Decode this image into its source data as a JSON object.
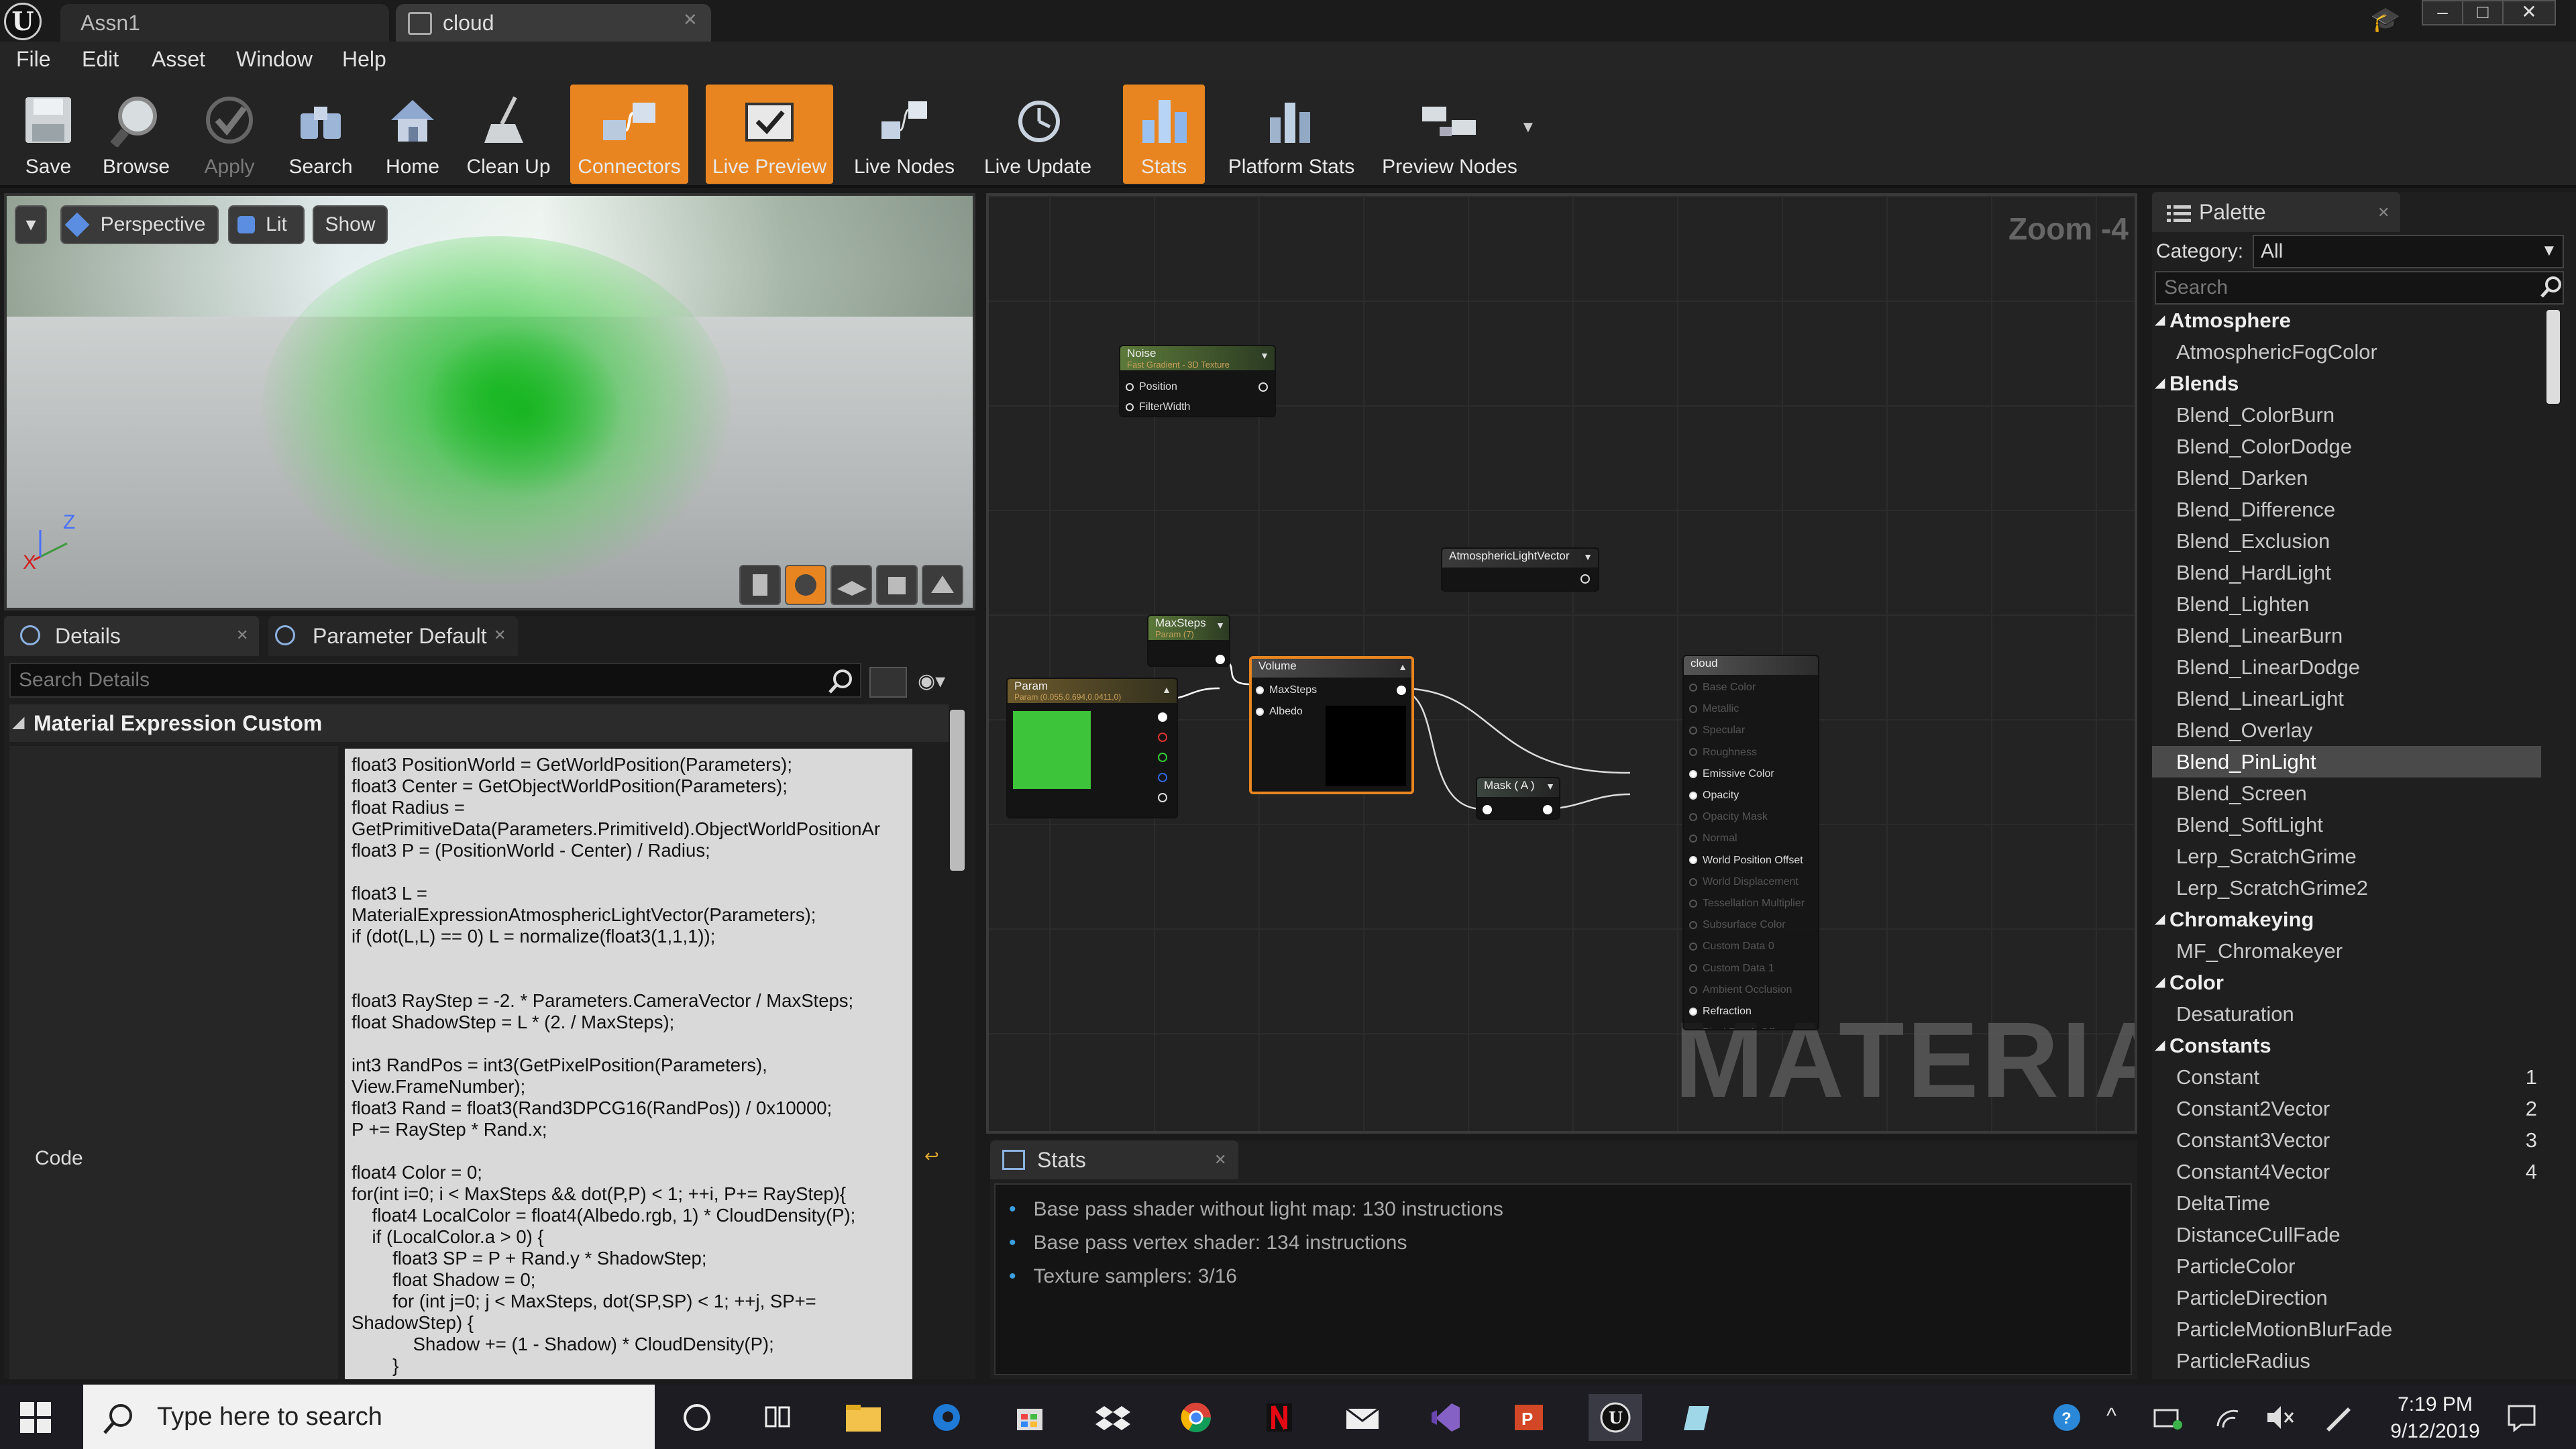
{
  "window": {
    "tabs": [
      {
        "label": "Assn1"
      },
      {
        "label": "cloud"
      }
    ],
    "controls": {
      "minimize": "–",
      "maximize": "□",
      "close": "✕"
    }
  },
  "menu": {
    "items": [
      "File",
      "Edit",
      "Asset",
      "Window",
      "Help"
    ]
  },
  "toolbar": {
    "buttons": [
      {
        "label": "Save",
        "icon": "save-icon",
        "active": false
      },
      {
        "label": "Browse",
        "icon": "browse-icon",
        "active": false
      },
      {
        "label": "Apply",
        "icon": "apply-icon",
        "active": false,
        "disabled": true
      },
      {
        "label": "Search",
        "icon": "search-icon",
        "active": false
      },
      {
        "label": "Home",
        "icon": "home-icon",
        "active": false
      },
      {
        "label": "Clean Up",
        "icon": "clean-up-icon",
        "active": false
      },
      {
        "label": "Connectors",
        "icon": "connectors-icon",
        "active": true
      },
      {
        "label": "Live Preview",
        "icon": "live-preview-icon",
        "active": true
      },
      {
        "label": "Live Nodes",
        "icon": "live-nodes-icon",
        "active": false
      },
      {
        "label": "Live Update",
        "icon": "live-update-icon",
        "active": false
      },
      {
        "label": "Stats",
        "icon": "stats-icon",
        "active": true
      },
      {
        "label": "Platform Stats",
        "icon": "platform-stats-icon",
        "active": false
      },
      {
        "label": "Preview Nodes",
        "icon": "preview-nodes-icon",
        "active": false
      }
    ],
    "accent": "#e98520"
  },
  "viewport": {
    "perspective": "Perspective",
    "lit": "Lit",
    "show": "Show",
    "axis_x": "X",
    "axis_z": "Z"
  },
  "details": {
    "tab_details": "Details",
    "tab_params": "Parameter Default",
    "search_placeholder": "Search Details",
    "section": "Material Expression Custom",
    "code_label": "Code",
    "code": "float3 PositionWorld = GetWorldPosition(Parameters);\nfloat3 Center = GetObjectWorldPosition(Parameters);\nfloat Radius =\nGetPrimitiveData(Parameters.PrimitiveId).ObjectWorldPositionAr\nfloat3 P = (PositionWorld - Center) / Radius;\n\nfloat3 L =\nMaterialExpressionAtmosphericLightVector(Parameters);\nif (dot(L,L) == 0) L = normalize(float3(1,1,1));\n\n\nfloat3 RayStep = -2. * Parameters.CameraVector / MaxSteps;\nfloat ShadowStep = L * (2. / MaxSteps);\n\nint3 RandPos = int3(GetPixelPosition(Parameters),\nView.FrameNumber);\nfloat3 Rand = float3(Rand3DPCG16(RandPos)) / 0x10000;\nP += RayStep * Rand.x;\n\nfloat4 Color = 0;\nfor(int i=0; i < MaxSteps && dot(P,P) < 1; ++i, P+= RayStep){\n    float4 LocalColor = float4(Albedo.rgb, 1) * CloudDensity(P);\n    if (LocalColor.a > 0) {\n        float3 SP = P + Rand.y * ShadowStep;\n        float Shadow = 0;\n        for (int j=0; j < MaxSteps, dot(SP,SP) < 1; ++j, SP+=\nShadowStep) {\n            Shadow += (1 - Shadow) * CloudDensity(P);\n        }"
  },
  "graph": {
    "zoom": "Zoom -4",
    "watermark": "MATERIAL",
    "nodes": {
      "noise": {
        "title": "Noise",
        "subtitle": "Fast Gradient - 3D Texture",
        "pins": [
          "Position",
          "FilterWidth"
        ]
      },
      "atmos": {
        "title": "AtmosphericLightVector"
      },
      "maxsteps": {
        "title": "MaxSteps",
        "subtitle": "Param (7)"
      },
      "param": {
        "title": "Param",
        "subtitle": "Param (0.055,0.694,0.0411,0)",
        "color": "#3dc43a"
      },
      "volume": {
        "title": "Volume",
        "pins": [
          "MaxSteps",
          "Albedo"
        ]
      },
      "mask": {
        "title": "Mask ( A )"
      },
      "cloud": {
        "title": "cloud",
        "pins": [
          {
            "label": "Base Color",
            "active": false
          },
          {
            "label": "Metallic",
            "active": false
          },
          {
            "label": "Specular",
            "active": false
          },
          {
            "label": "Roughness",
            "active": false
          },
          {
            "label": "Emissive Color",
            "active": true
          },
          {
            "label": "Opacity",
            "active": true
          },
          {
            "label": "Opacity Mask",
            "active": false
          },
          {
            "label": "Normal",
            "active": false
          },
          {
            "label": "World Position Offset",
            "active": true
          },
          {
            "label": "World Displacement",
            "active": false
          },
          {
            "label": "Tessellation Multiplier",
            "active": false
          },
          {
            "label": "Subsurface Color",
            "active": false
          },
          {
            "label": "Custom Data 0",
            "active": false
          },
          {
            "label": "Custom Data 1",
            "active": false
          },
          {
            "label": "Ambient Occlusion",
            "active": false
          },
          {
            "label": "Refraction",
            "active": true
          },
          {
            "label": "Pixel Depth Offset",
            "active": false
          }
        ]
      }
    }
  },
  "palette": {
    "tab": "Palette",
    "category_label": "Category:",
    "category_value": "All",
    "search_placeholder": "Search",
    "rows": [
      {
        "type": "cat",
        "label": "Atmosphere"
      },
      {
        "type": "item",
        "label": "AtmosphericFogColor"
      },
      {
        "type": "cat",
        "label": "Blends"
      },
      {
        "type": "item",
        "label": "Blend_ColorBurn"
      },
      {
        "type": "item",
        "label": "Blend_ColorDodge"
      },
      {
        "type": "item",
        "label": "Blend_Darken"
      },
      {
        "type": "item",
        "label": "Blend_Difference"
      },
      {
        "type": "item",
        "label": "Blend_Exclusion"
      },
      {
        "type": "item",
        "label": "Blend_HardLight"
      },
      {
        "type": "item",
        "label": "Blend_Lighten"
      },
      {
        "type": "item",
        "label": "Blend_LinearBurn"
      },
      {
        "type": "item",
        "label": "Blend_LinearDodge"
      },
      {
        "type": "item",
        "label": "Blend_LinearLight"
      },
      {
        "type": "item",
        "label": "Blend_Overlay"
      },
      {
        "type": "item",
        "label": "Blend_PinLight",
        "selected": true
      },
      {
        "type": "item",
        "label": "Blend_Screen"
      },
      {
        "type": "item",
        "label": "Blend_SoftLight"
      },
      {
        "type": "item",
        "label": "Lerp_ScratchGrime"
      },
      {
        "type": "item",
        "label": "Lerp_ScratchGrime2"
      },
      {
        "type": "cat",
        "label": "Chromakeying"
      },
      {
        "type": "item",
        "label": "MF_Chromakeyer"
      },
      {
        "type": "cat",
        "label": "Color"
      },
      {
        "type": "item",
        "label": "Desaturation"
      },
      {
        "type": "cat",
        "label": "Constants"
      },
      {
        "type": "item",
        "label": "Constant",
        "hotkey": "1"
      },
      {
        "type": "item",
        "label": "Constant2Vector",
        "hotkey": "2"
      },
      {
        "type": "item",
        "label": "Constant3Vector",
        "hotkey": "3"
      },
      {
        "type": "item",
        "label": "Constant4Vector",
        "hotkey": "4"
      },
      {
        "type": "item",
        "label": "DeltaTime"
      },
      {
        "type": "item",
        "label": "DistanceCullFade"
      },
      {
        "type": "item",
        "label": "ParticleColor"
      },
      {
        "type": "item",
        "label": "ParticleDirection"
      },
      {
        "type": "item",
        "label": "ParticleMotionBlurFade"
      },
      {
        "type": "item",
        "label": "ParticleRadius"
      }
    ]
  },
  "stats": {
    "tab": "Stats",
    "lines": [
      "Base pass shader without light map: 130 instructions",
      "Base pass vertex shader: 134 instructions",
      "Texture samplers: 3/16"
    ]
  },
  "taskbar": {
    "search_placeholder": "Type here to search",
    "time": "7:19 PM",
    "date": "9/12/2019"
  }
}
